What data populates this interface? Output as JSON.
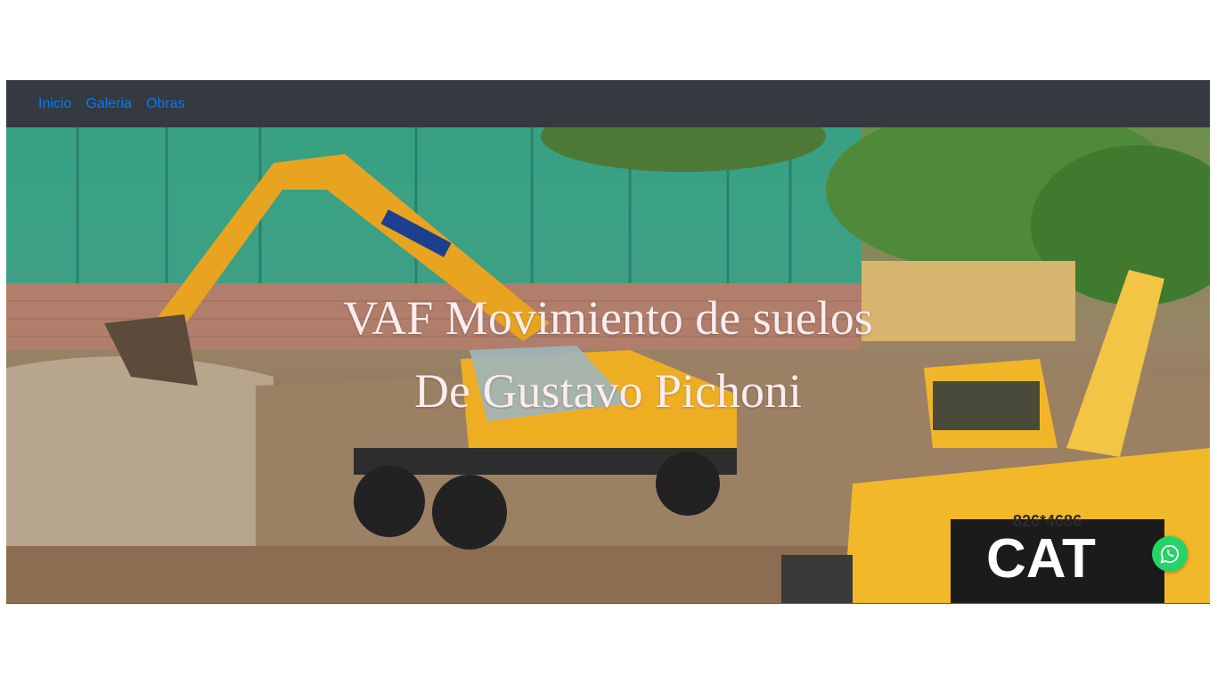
{
  "nav": {
    "items": [
      {
        "label": "Inicio"
      },
      {
        "label": "Galeria"
      },
      {
        "label": "Obras"
      }
    ]
  },
  "hero": {
    "title": "VAF Movimiento de suelos",
    "subtitle": "De Gustavo Pichoni",
    "image_description_icon": "excavator-photo",
    "machine_badge": "CAT",
    "machine_number": "826*4686"
  },
  "whatsapp": {
    "icon": "whatsapp-icon",
    "color": "#25d366"
  },
  "colors": {
    "navbar_bg": "#343a40",
    "link": "#007bff",
    "hero_text": "#fbecee"
  }
}
